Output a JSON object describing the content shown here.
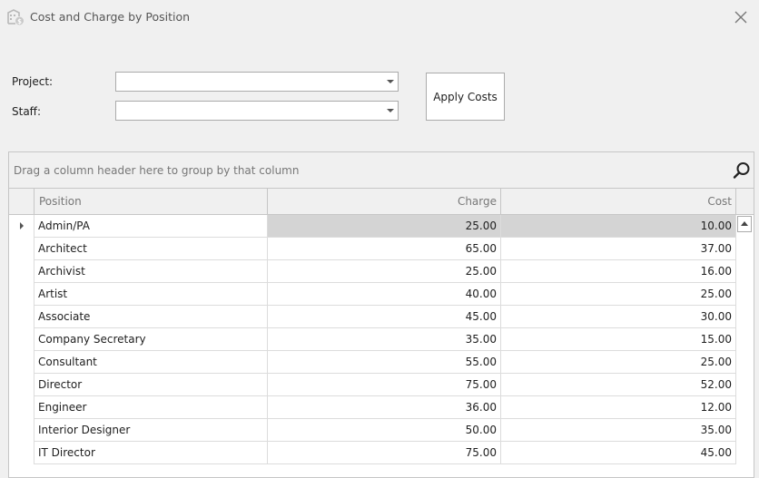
{
  "window": {
    "title": "Cost and Charge by Position",
    "icon": "building-dollar-icon",
    "close_icon": "close-icon"
  },
  "filters": {
    "project_label": "Project:",
    "project_value": "",
    "staff_label": "Staff:",
    "staff_value": "",
    "apply_label": "Apply Costs"
  },
  "grid": {
    "group_panel_text": "Drag a column header here to group by that column",
    "search_icon": "search-icon",
    "columns": {
      "position": "Position",
      "charge": "Charge",
      "cost": "Cost"
    },
    "focused_row": 0,
    "rows": [
      {
        "position": "Admin/PA",
        "charge": "25.00",
        "cost": "10.00"
      },
      {
        "position": "Architect",
        "charge": "65.00",
        "cost": "37.00"
      },
      {
        "position": "Archivist",
        "charge": "25.00",
        "cost": "16.00"
      },
      {
        "position": "Artist",
        "charge": "40.00",
        "cost": "25.00"
      },
      {
        "position": "Associate",
        "charge": "45.00",
        "cost": "30.00"
      },
      {
        "position": "Company Secretary",
        "charge": "35.00",
        "cost": "15.00"
      },
      {
        "position": "Consultant",
        "charge": "55.00",
        "cost": "25.00"
      },
      {
        "position": "Director",
        "charge": "75.00",
        "cost": "52.00"
      },
      {
        "position": "Engineer",
        "charge": "36.00",
        "cost": "12.00"
      },
      {
        "position": "Interior Designer",
        "charge": "50.00",
        "cost": "35.00"
      },
      {
        "position": "IT Director",
        "charge": "75.00",
        "cost": "45.00"
      }
    ]
  },
  "colors": {
    "background": "#f0f0f0",
    "focused_cell": "#d4d4d4",
    "border": "#c6c6c6"
  }
}
